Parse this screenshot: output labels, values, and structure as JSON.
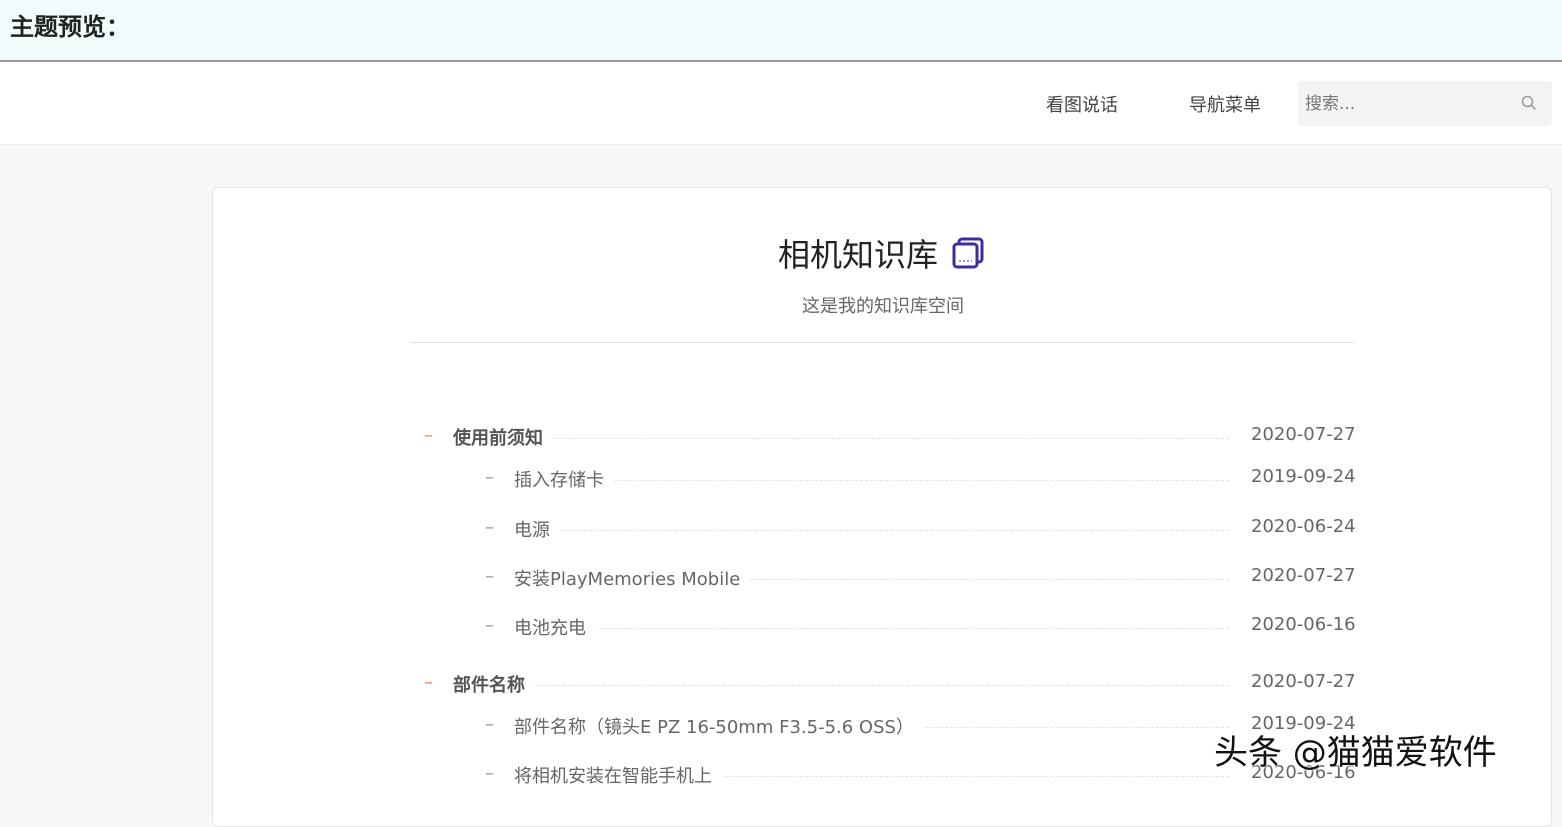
{
  "banner": {
    "title": "主题预览："
  },
  "nav": {
    "links": [
      "看图说话",
      "导航菜单"
    ],
    "search_placeholder": "搜索..."
  },
  "kb": {
    "title": "相机知识库",
    "subtitle": "这是我的知识库空间"
  },
  "toc": [
    {
      "label": "使用前须知",
      "date": "2020-07-27",
      "level": 1
    },
    {
      "label": "插入存储卡",
      "date": "2019-09-24",
      "level": 2
    },
    {
      "label": "电源",
      "date": "2020-06-24",
      "level": 2
    },
    {
      "label": "安装PlayMemories Mobile",
      "date": "2020-07-27",
      "level": 2
    },
    {
      "label": "电池充电",
      "date": "2020-06-16",
      "level": 2
    },
    {
      "label": "部件名称",
      "date": "2020-07-27",
      "level": 1
    },
    {
      "label": "部件名称（镜头E PZ 16-50mm F3.5-5.6 OSS）",
      "date": "2019-09-24",
      "level": 2
    },
    {
      "label": "将相机安装在智能手机上",
      "date": "2020-06-16",
      "level": 2
    }
  ],
  "watermark": "头条 @猫猫爱软件",
  "colors": {
    "accent_dash": "#e08a5a",
    "kb_icon": "#3b2fa0",
    "banner_bg": "#f0fbfb"
  }
}
